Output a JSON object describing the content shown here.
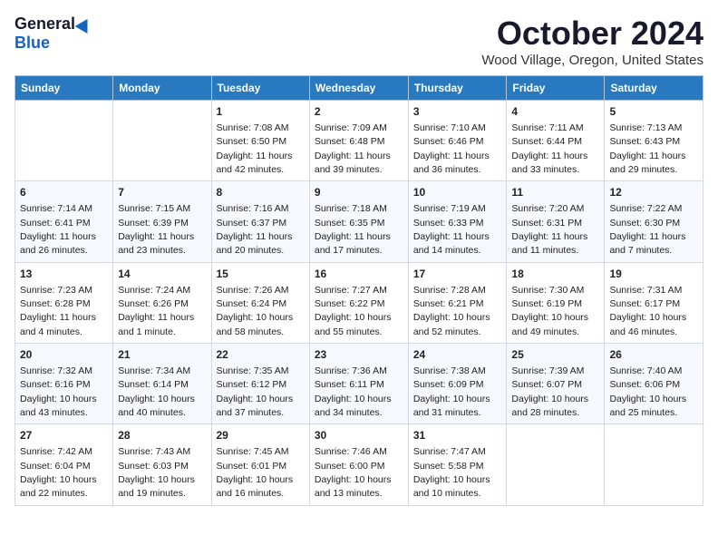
{
  "header": {
    "logo_general": "General",
    "logo_blue": "Blue",
    "month_title": "October 2024",
    "location": "Wood Village, Oregon, United States"
  },
  "days_of_week": [
    "Sunday",
    "Monday",
    "Tuesday",
    "Wednesday",
    "Thursday",
    "Friday",
    "Saturday"
  ],
  "weeks": [
    [
      {
        "day": "",
        "sunrise": "",
        "sunset": "",
        "daylight": ""
      },
      {
        "day": "",
        "sunrise": "",
        "sunset": "",
        "daylight": ""
      },
      {
        "day": "1",
        "sunrise": "Sunrise: 7:08 AM",
        "sunset": "Sunset: 6:50 PM",
        "daylight": "Daylight: 11 hours and 42 minutes."
      },
      {
        "day": "2",
        "sunrise": "Sunrise: 7:09 AM",
        "sunset": "Sunset: 6:48 PM",
        "daylight": "Daylight: 11 hours and 39 minutes."
      },
      {
        "day": "3",
        "sunrise": "Sunrise: 7:10 AM",
        "sunset": "Sunset: 6:46 PM",
        "daylight": "Daylight: 11 hours and 36 minutes."
      },
      {
        "day": "4",
        "sunrise": "Sunrise: 7:11 AM",
        "sunset": "Sunset: 6:44 PM",
        "daylight": "Daylight: 11 hours and 33 minutes."
      },
      {
        "day": "5",
        "sunrise": "Sunrise: 7:13 AM",
        "sunset": "Sunset: 6:43 PM",
        "daylight": "Daylight: 11 hours and 29 minutes."
      }
    ],
    [
      {
        "day": "6",
        "sunrise": "Sunrise: 7:14 AM",
        "sunset": "Sunset: 6:41 PM",
        "daylight": "Daylight: 11 hours and 26 minutes."
      },
      {
        "day": "7",
        "sunrise": "Sunrise: 7:15 AM",
        "sunset": "Sunset: 6:39 PM",
        "daylight": "Daylight: 11 hours and 23 minutes."
      },
      {
        "day": "8",
        "sunrise": "Sunrise: 7:16 AM",
        "sunset": "Sunset: 6:37 PM",
        "daylight": "Daylight: 11 hours and 20 minutes."
      },
      {
        "day": "9",
        "sunrise": "Sunrise: 7:18 AM",
        "sunset": "Sunset: 6:35 PM",
        "daylight": "Daylight: 11 hours and 17 minutes."
      },
      {
        "day": "10",
        "sunrise": "Sunrise: 7:19 AM",
        "sunset": "Sunset: 6:33 PM",
        "daylight": "Daylight: 11 hours and 14 minutes."
      },
      {
        "day": "11",
        "sunrise": "Sunrise: 7:20 AM",
        "sunset": "Sunset: 6:31 PM",
        "daylight": "Daylight: 11 hours and 11 minutes."
      },
      {
        "day": "12",
        "sunrise": "Sunrise: 7:22 AM",
        "sunset": "Sunset: 6:30 PM",
        "daylight": "Daylight: 11 hours and 7 minutes."
      }
    ],
    [
      {
        "day": "13",
        "sunrise": "Sunrise: 7:23 AM",
        "sunset": "Sunset: 6:28 PM",
        "daylight": "Daylight: 11 hours and 4 minutes."
      },
      {
        "day": "14",
        "sunrise": "Sunrise: 7:24 AM",
        "sunset": "Sunset: 6:26 PM",
        "daylight": "Daylight: 11 hours and 1 minute."
      },
      {
        "day": "15",
        "sunrise": "Sunrise: 7:26 AM",
        "sunset": "Sunset: 6:24 PM",
        "daylight": "Daylight: 10 hours and 58 minutes."
      },
      {
        "day": "16",
        "sunrise": "Sunrise: 7:27 AM",
        "sunset": "Sunset: 6:22 PM",
        "daylight": "Daylight: 10 hours and 55 minutes."
      },
      {
        "day": "17",
        "sunrise": "Sunrise: 7:28 AM",
        "sunset": "Sunset: 6:21 PM",
        "daylight": "Daylight: 10 hours and 52 minutes."
      },
      {
        "day": "18",
        "sunrise": "Sunrise: 7:30 AM",
        "sunset": "Sunset: 6:19 PM",
        "daylight": "Daylight: 10 hours and 49 minutes."
      },
      {
        "day": "19",
        "sunrise": "Sunrise: 7:31 AM",
        "sunset": "Sunset: 6:17 PM",
        "daylight": "Daylight: 10 hours and 46 minutes."
      }
    ],
    [
      {
        "day": "20",
        "sunrise": "Sunrise: 7:32 AM",
        "sunset": "Sunset: 6:16 PM",
        "daylight": "Daylight: 10 hours and 43 minutes."
      },
      {
        "day": "21",
        "sunrise": "Sunrise: 7:34 AM",
        "sunset": "Sunset: 6:14 PM",
        "daylight": "Daylight: 10 hours and 40 minutes."
      },
      {
        "day": "22",
        "sunrise": "Sunrise: 7:35 AM",
        "sunset": "Sunset: 6:12 PM",
        "daylight": "Daylight: 10 hours and 37 minutes."
      },
      {
        "day": "23",
        "sunrise": "Sunrise: 7:36 AM",
        "sunset": "Sunset: 6:11 PM",
        "daylight": "Daylight: 10 hours and 34 minutes."
      },
      {
        "day": "24",
        "sunrise": "Sunrise: 7:38 AM",
        "sunset": "Sunset: 6:09 PM",
        "daylight": "Daylight: 10 hours and 31 minutes."
      },
      {
        "day": "25",
        "sunrise": "Sunrise: 7:39 AM",
        "sunset": "Sunset: 6:07 PM",
        "daylight": "Daylight: 10 hours and 28 minutes."
      },
      {
        "day": "26",
        "sunrise": "Sunrise: 7:40 AM",
        "sunset": "Sunset: 6:06 PM",
        "daylight": "Daylight: 10 hours and 25 minutes."
      }
    ],
    [
      {
        "day": "27",
        "sunrise": "Sunrise: 7:42 AM",
        "sunset": "Sunset: 6:04 PM",
        "daylight": "Daylight: 10 hours and 22 minutes."
      },
      {
        "day": "28",
        "sunrise": "Sunrise: 7:43 AM",
        "sunset": "Sunset: 6:03 PM",
        "daylight": "Daylight: 10 hours and 19 minutes."
      },
      {
        "day": "29",
        "sunrise": "Sunrise: 7:45 AM",
        "sunset": "Sunset: 6:01 PM",
        "daylight": "Daylight: 10 hours and 16 minutes."
      },
      {
        "day": "30",
        "sunrise": "Sunrise: 7:46 AM",
        "sunset": "Sunset: 6:00 PM",
        "daylight": "Daylight: 10 hours and 13 minutes."
      },
      {
        "day": "31",
        "sunrise": "Sunrise: 7:47 AM",
        "sunset": "Sunset: 5:58 PM",
        "daylight": "Daylight: 10 hours and 10 minutes."
      },
      {
        "day": "",
        "sunrise": "",
        "sunset": "",
        "daylight": ""
      },
      {
        "day": "",
        "sunrise": "",
        "sunset": "",
        "daylight": ""
      }
    ]
  ]
}
